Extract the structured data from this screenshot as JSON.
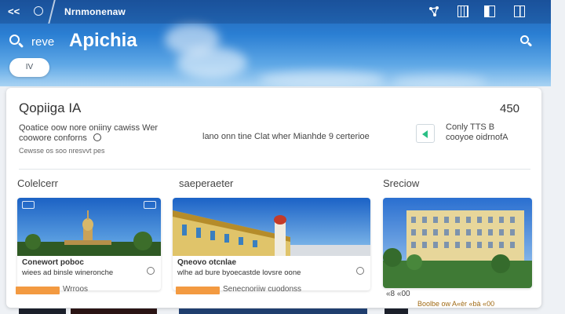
{
  "topbar": {
    "back_icon": "double-chevron-left",
    "title": "Nrnmonenaw",
    "icons": [
      "share-icon",
      "grid-icon",
      "book-icon",
      "document-icon"
    ]
  },
  "hero": {
    "search_prefix": "reve",
    "search_title": "Apichia",
    "pill_label": "IV"
  },
  "info": {
    "title": "Qopiiga IA",
    "count": "450",
    "desc_line1": "Qoatice oow nore oniiny cawiss Wer",
    "desc_line2": "coowore conforns",
    "desc_line3": "Cewsse os soo nresvvt pes",
    "center_text": "lano onn tine Clat wher Mianhde 9 certerioe",
    "side_line1": "Conly TTS B",
    "side_line2": "cooyoe oidrnofA"
  },
  "sections": [
    {
      "label": "Colelcerr"
    },
    {
      "label": "saeperaeter"
    },
    {
      "label": "Sreciow"
    }
  ],
  "cards": [
    {
      "caption_line1": "Conewort poboc",
      "caption_line2": "wiees ad binsle wineronche",
      "tag_text": "Wrroos"
    },
    {
      "caption_line1": "Qneovo otcnlae",
      "caption_line2": "wlhe ad bure byoecastde lovsre oone",
      "tag_text": "Senecnoriiw cuodonss"
    },
    {
      "meta": "«8 «00",
      "sub": "Boolbe ow A«èr «bà «00"
    }
  ],
  "colors": {
    "hero_top": "#1f5fb0",
    "hero_bottom": "#a9d3f3",
    "accent_tag": "#f39a41",
    "toggle_indicator": "#2bbf85"
  }
}
